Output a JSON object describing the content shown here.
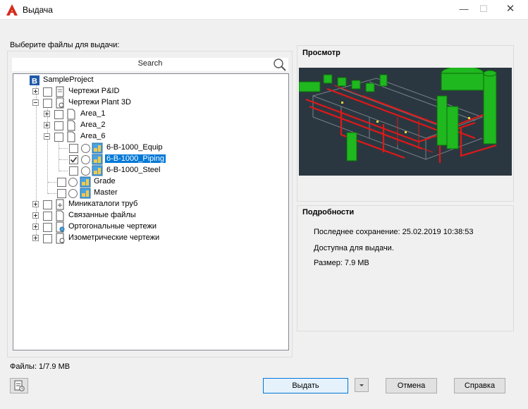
{
  "window": {
    "title": "Выдача",
    "accent": "#d52b1e"
  },
  "instructions": "Выберите файлы для выдачи:",
  "search": {
    "label": "Search",
    "icon": "search-icon"
  },
  "tree": [
    {
      "label": "SampleProject",
      "icon": "project-b-icon"
    },
    {
      "label": "Чертежи P&ID",
      "icon": "pid-drawings-icon"
    },
    {
      "label": "Чертежи Plant 3D",
      "icon": "plant3d-drawings-icon"
    },
    {
      "label": "Area_1",
      "icon": "folder-icon"
    },
    {
      "label": "Area_2",
      "icon": "folder-icon"
    },
    {
      "label": "Area_6",
      "icon": "folder-icon"
    },
    {
      "label": "6-B-1000_Equip",
      "icon": "model-icon"
    },
    {
      "label": "6-B-1000_Piping",
      "icon": "model-icon",
      "checked": true,
      "selected": true
    },
    {
      "label": "6-B-1000_Steel",
      "icon": "model-icon"
    },
    {
      "label": "Grade",
      "icon": "model-icon"
    },
    {
      "label": "Master",
      "icon": "model-icon"
    },
    {
      "label": "Миникаталоги труб",
      "icon": "spec-sheet-icon"
    },
    {
      "label": "Связанные файлы",
      "icon": "related-files-icon"
    },
    {
      "label": "Ортогональные чертежи",
      "icon": "ortho-drawings-icon"
    },
    {
      "label": "Изометрические чертежи",
      "icon": "iso-drawings-icon"
    }
  ],
  "preview": {
    "title": "Просмотр"
  },
  "details": {
    "title": "Подробности",
    "last_saved": "Последнее сохранение: 25.02.2019 10:38:53",
    "status": "Доступна для выдачи.",
    "size": "Размер: 7.9 MB"
  },
  "files_summary": "Файлы: 1/7.9 MB",
  "buttons": {
    "checkout": "Выдать",
    "cancel": "Отмена",
    "help": "Справка"
  }
}
